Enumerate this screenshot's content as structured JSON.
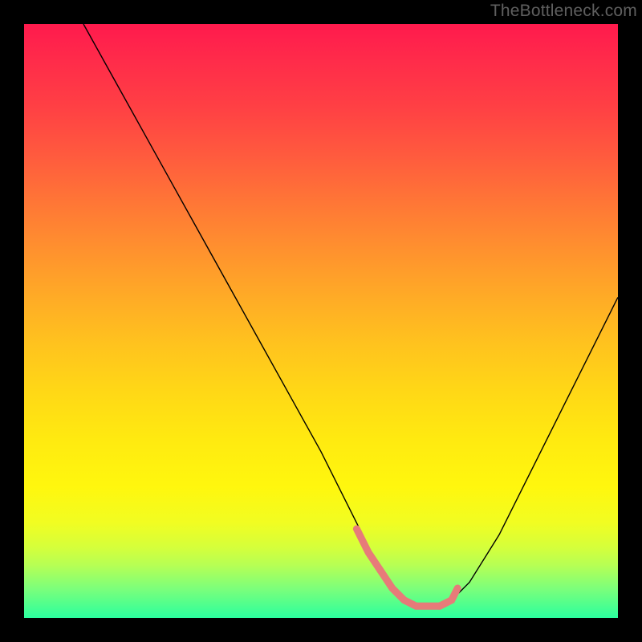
{
  "watermark": "TheBottleneck.com",
  "chart_data": {
    "type": "line",
    "title": "",
    "xlabel": "",
    "ylabel": "",
    "xlim": [
      0,
      100
    ],
    "ylim": [
      0,
      100
    ],
    "grid": false,
    "legend": false,
    "background_gradient": {
      "top": "#ff1a4d",
      "bottom": "#2bff9e"
    },
    "series": [
      {
        "name": "curve",
        "x": [
          10,
          15,
          20,
          25,
          30,
          35,
          40,
          45,
          50,
          55,
          58,
          60,
          62,
          64,
          66,
          68,
          70,
          72,
          75,
          80,
          85,
          90,
          95,
          100
        ],
        "y": [
          100,
          91,
          82,
          73,
          64,
          55,
          46,
          37,
          28,
          18,
          12,
          8,
          5,
          3,
          2,
          2,
          2,
          3,
          6,
          14,
          24,
          34,
          44,
          54
        ]
      }
    ],
    "highlight": {
      "name": "bottom-marker",
      "color": "#e77b79",
      "x": [
        56,
        58,
        60,
        62,
        64,
        66,
        68,
        70,
        72,
        73
      ],
      "y": [
        15,
        11,
        8,
        5,
        3,
        2,
        2,
        2,
        3,
        5
      ]
    }
  }
}
